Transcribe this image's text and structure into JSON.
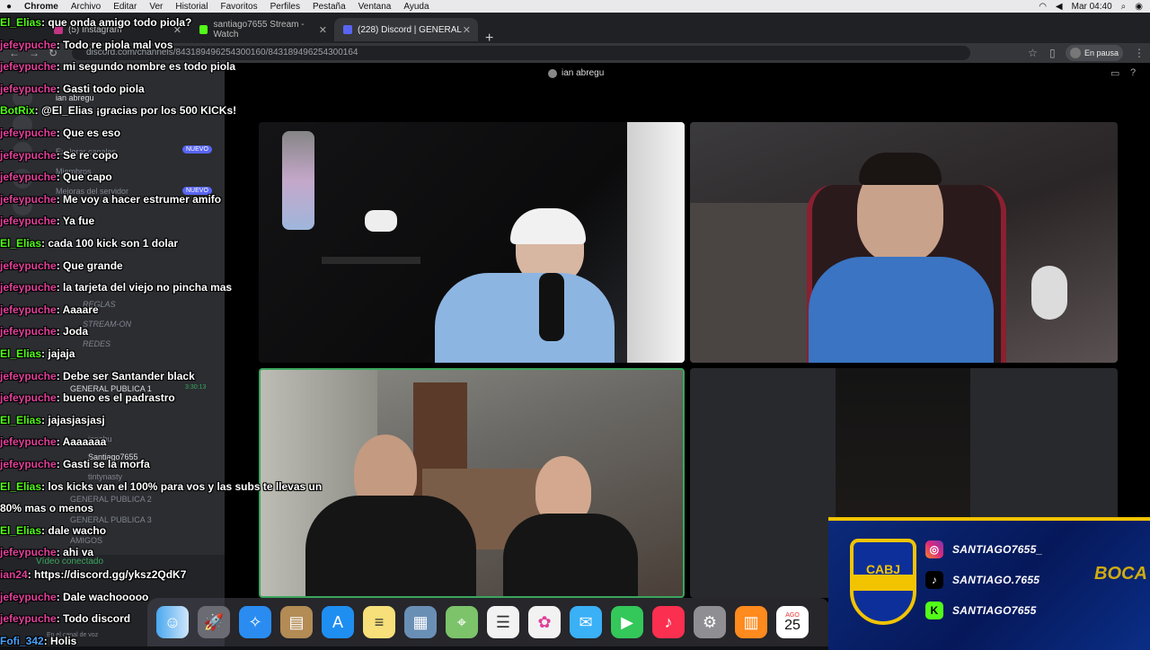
{
  "menubar": {
    "items": [
      "Chrome",
      "Archivo",
      "Editar",
      "Ver",
      "Historial",
      "Favoritos",
      "Perfiles",
      "Pestaña",
      "Ventana",
      "Ayuda"
    ],
    "clock": "Mar 04:40"
  },
  "tabs": [
    {
      "label": "(5) Instagram"
    },
    {
      "label": "santiago7655 Stream - Watch"
    },
    {
      "label": "(228) Discord | GENERAL"
    }
  ],
  "address": {
    "url": "discord.com/channels/843189496254300160/843189496254300164",
    "paused_label": "En pausa"
  },
  "discord": {
    "channel_user": "ian abregu",
    "sidebar": {
      "server_user": "ian abregu",
      "items": [
        "Explorar canales",
        "Miembros",
        "Mejoras del servidor",
        "REGLAS",
        "STREAM-ON",
        "REDES",
        "GENERAL PUBLICA 1",
        "GENERAL PUBLICA 2",
        "GENERAL PUBLICA 3",
        "AMIGOS"
      ],
      "badge_new": "NUEVO",
      "timer": "3:30:13",
      "voice_users": [
        "ianchu",
        "Santiago7655",
        "tintynasty"
      ],
      "video_connected": "Vídeo conectado",
      "voice_channel": "En el canal de voz"
    }
  },
  "chat": {
    "messages": [
      {
        "user": "El_Elias",
        "text": ": que onda amigo todo piola?",
        "color": "g"
      },
      {
        "user": "jefeypuche",
        "text": ": Todo re piola mal vos",
        "color": "p"
      },
      {
        "user": "jefeypuche",
        "text": ": mi segundo nombre es todo piola",
        "color": "p"
      },
      {
        "user": "jefeypuche",
        "text": ": Gasti todo piola",
        "color": "p"
      },
      {
        "user": "BotRix",
        "text": ": @El_Elias ¡gracias por los 500 KICKs!",
        "color": "g"
      },
      {
        "user": "jefeypuche",
        "text": ": Que es eso",
        "color": "p"
      },
      {
        "user": "jefeypuche",
        "text": ": Se re copo",
        "color": "p"
      },
      {
        "user": "jefeypuche",
        "text": ": Que capo",
        "color": "p"
      },
      {
        "user": "jefeypuche",
        "text": ": Me voy a hacer estrumer amifo",
        "color": "p"
      },
      {
        "user": "jefeypuche",
        "text": ": Ya fue",
        "color": "p"
      },
      {
        "user": "El_Elias",
        "text": ": cada 100 kick son 1 dolar",
        "color": "g"
      },
      {
        "user": "jefeypuche",
        "text": ": Que grande",
        "color": "p"
      },
      {
        "user": "jefeypuche",
        "text": ": la tarjeta del viejo no pincha mas",
        "color": "p"
      },
      {
        "user": "jefeypuche",
        "text": ": Aaaare",
        "color": "p"
      },
      {
        "user": "jefeypuche",
        "text": ": Joda",
        "color": "p"
      },
      {
        "user": "El_Elias",
        "text": ": jajaja",
        "color": "g"
      },
      {
        "user": "jefeypuche",
        "text": ": Debe ser Santander black",
        "color": "p"
      },
      {
        "user": "jefeypuche",
        "text": ": bueno es el padrastro",
        "color": "p"
      },
      {
        "user": "El_Elias",
        "text": ": jajasjasjasj",
        "color": "g"
      },
      {
        "user": "jefeypuche",
        "text": ": Aaaaaaa",
        "color": "p"
      },
      {
        "user": "jefeypuche",
        "text": ": Gasti se la morfa",
        "color": "p"
      },
      {
        "user": "El_Elias",
        "text": ": los kicks van el 100% para vos y las subs te llevas un",
        "color": "g"
      },
      {
        "user": "",
        "text": "80% mas o menos",
        "color": "p"
      },
      {
        "user": "El_Elias",
        "text": ": dale wacho",
        "color": "g"
      },
      {
        "user": "jefeypuche",
        "text": ": ahi va",
        "color": "p"
      },
      {
        "user": "ian24",
        "text": ": https://discord.gg/yksz2QdK7",
        "color": "p"
      },
      {
        "user": "jefeypuche",
        "text": ": Dale wachooooo",
        "color": "p"
      },
      {
        "user": "jefeypuche",
        "text": ": Todo discord",
        "color": "p"
      },
      {
        "user": "Fofi_342",
        "text": ": Holis",
        "color": "b"
      }
    ]
  },
  "social": {
    "instagram": "SANTIAGO7655_",
    "tiktok": "SANTIAGO.7655",
    "kick": "SANTIAGO7655",
    "crest": "CABJ",
    "brand": "BOCA"
  },
  "dock": {
    "calendar_month": "AGO",
    "calendar_day": "25"
  },
  "colors": {
    "chat_user": "#e0409a",
    "chat_user_green": "#53fc18",
    "speaking_border": "#3ba55d",
    "boca_blue": "#0b2a7a",
    "boca_gold": "#f2c400"
  }
}
